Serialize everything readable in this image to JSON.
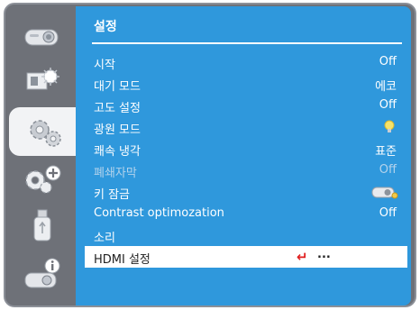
{
  "menu": {
    "title": "설정",
    "items": [
      {
        "label": "시작",
        "value": "Off"
      },
      {
        "label": "대기 모드",
        "value": "에코"
      },
      {
        "label": "고도 설정",
        "value": "Off"
      },
      {
        "label": "광원 모드",
        "value": "",
        "icon": "lightbulb-icon"
      },
      {
        "label": "쾌속 냉각",
        "value": "표준"
      },
      {
        "label": "폐쇄자막",
        "value": "Off",
        "disabled": true
      },
      {
        "label": "키 잠금",
        "value": "",
        "icon": "projector-lock-icon"
      },
      {
        "label": "Contrast optimozation",
        "value": "Off"
      },
      {
        "label": "소리",
        "value": ""
      },
      {
        "label": "HDMI 설정",
        "value": "...",
        "selected": true,
        "icon": "enter-arrow-icon"
      }
    ]
  },
  "sidebar": {
    "tabs": [
      {
        "name": "projector-icon"
      },
      {
        "name": "display-adjust-icon"
      },
      {
        "name": "settings-gear-icon",
        "active": true
      },
      {
        "name": "expanded-settings-icon"
      },
      {
        "name": "usb-memory-icon"
      },
      {
        "name": "info-icon"
      }
    ]
  },
  "colors": {
    "panel": "#2f98dc",
    "frame": "#6e7178",
    "sidebar_active": "#f2f3f5",
    "enter_arrow": "#e01e1e"
  }
}
